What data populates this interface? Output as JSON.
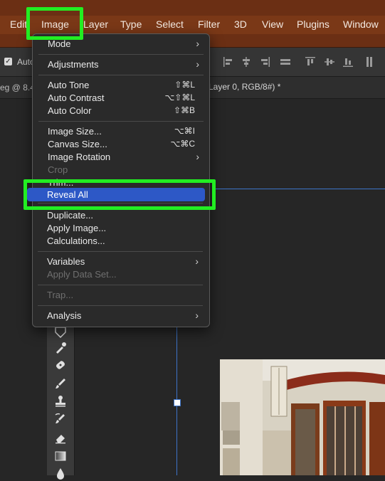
{
  "menubar": {
    "items": [
      "Edit",
      "Image",
      "Layer",
      "Type",
      "Select",
      "Filter",
      "3D",
      "View",
      "Plugins",
      "Window"
    ]
  },
  "options": {
    "auto_label": "Auto"
  },
  "tabs": {
    "left": "eg @ 8.4",
    "right": "Layer 0, RGB/8#) *"
  },
  "dropdown": {
    "mode": "Mode",
    "adjustments": "Adjustments",
    "auto_tone": "Auto Tone",
    "auto_tone_sc": "⇧⌘L",
    "auto_contrast": "Auto Contrast",
    "auto_contrast_sc": "⌥⇧⌘L",
    "auto_color": "Auto Color",
    "auto_color_sc": "⇧⌘B",
    "image_size": "Image Size...",
    "image_size_sc": "⌥⌘I",
    "canvas_size": "Canvas Size...",
    "canvas_size_sc": "⌥⌘C",
    "image_rotation": "Image Rotation",
    "crop": "Crop",
    "trim": "Trim...",
    "reveal_all": "Reveal All",
    "duplicate": "Duplicate...",
    "apply_image": "Apply Image...",
    "calculations": "Calculations...",
    "variables": "Variables",
    "apply_data_set": "Apply Data Set...",
    "trap": "Trap...",
    "analysis": "Analysis"
  },
  "colors": {
    "highlight": "#22ee22",
    "selection": "#2d58c6",
    "menubar": "#7a3817"
  }
}
